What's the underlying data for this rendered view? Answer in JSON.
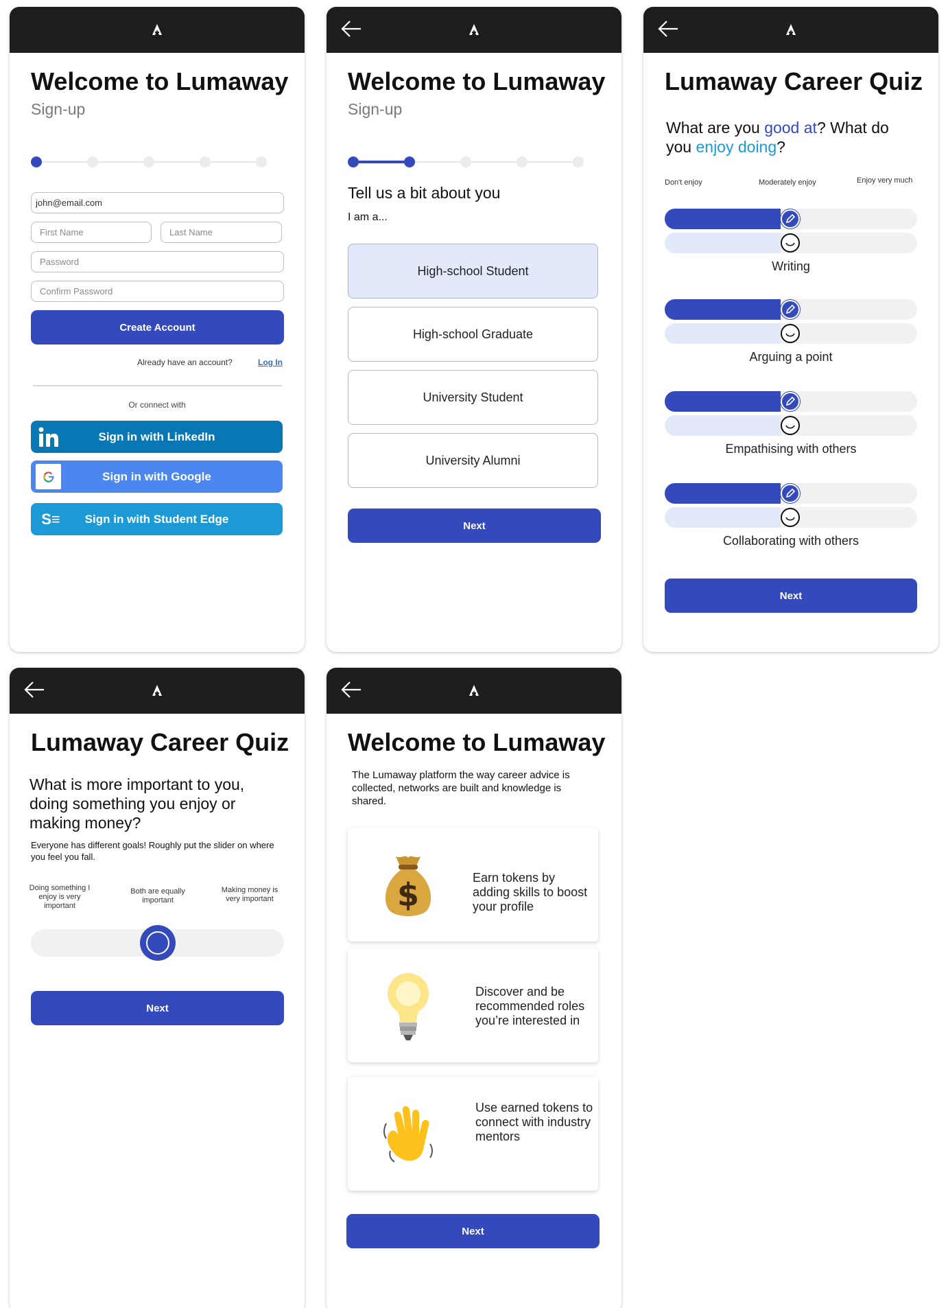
{
  "screen1": {
    "title": "Welcome to Lumaway",
    "subtitle": "Sign-up",
    "email_value": "john@email.com",
    "first_name_placeholder": "First Name",
    "last_name_placeholder": "Last Name",
    "password_placeholder": "Password",
    "confirm_password_placeholder": "Confirm Password",
    "create_account": "Create Account",
    "have_account": "Already have an account?",
    "login_link": "Log In",
    "or_connect": "Or connect with",
    "linkedin": "Sign in with LinkedIn",
    "google": "Sign in with Google",
    "student_edge": "Sign in with Student Edge",
    "student_edge_logo": "S≡"
  },
  "screen2": {
    "title": "Welcome to Lumaway",
    "subtitle": "Sign-up",
    "heading": "Tell us a bit about you",
    "prompt": "I am a...",
    "options": [
      "High-school Student",
      "High-school Graduate",
      "University Student",
      "University Alumni"
    ],
    "selected": "High-school Student",
    "next": "Next"
  },
  "screen3": {
    "title": "Lumaway Career Quiz",
    "question_pre": "What are you ",
    "question_good_at": "good at",
    "question_mid": "? What do you ",
    "question_enjoy": "enjoy doing",
    "question_end": "?",
    "scale_low": "Don't enjoy",
    "scale_mid": "Moderately enjoy",
    "scale_high": "Enjoy very much",
    "skills": [
      {
        "label": "Writing",
        "skill_level": 0.46,
        "enjoy_level": 0.46
      },
      {
        "label": "Arguing a point",
        "skill_level": 0.46,
        "enjoy_level": 0.46
      },
      {
        "label": "Empathising with others",
        "skill_level": 0.46,
        "enjoy_level": 0.46
      },
      {
        "label": "Collaborating with others",
        "skill_level": 0.46,
        "enjoy_level": 0.46
      }
    ],
    "next": "Next",
    "colors": {
      "good_at": "#3449bb",
      "enjoy": "#1c9ad6"
    }
  },
  "screen4": {
    "title": "Lumaway Career Quiz",
    "question": "What is more important to you, doing something you enjoy or making money?",
    "helper": "Everyone has different goals! Roughly put the slider on where you feel you fall.",
    "label_left": "Doing something I enjoy is very important",
    "label_mid": "Both are equally important",
    "label_right": "Making money is very important",
    "slider_value": 0.5,
    "next": "Next"
  },
  "screen5": {
    "title": "Welcome to Lumaway",
    "intro": "The Lumaway platform the way career advice is collected, networks are built and knowledge is shared.",
    "cards": [
      {
        "icon": "money-bag-icon",
        "text": "Earn tokens by adding skills to boost your profile"
      },
      {
        "icon": "light-bulb-icon",
        "text": "Discover and be recommended roles you’re interested in"
      },
      {
        "icon": "waving-hand-icon",
        "text": "Use earned tokens to connect with industry mentors"
      }
    ],
    "next": "Next"
  },
  "colors": {
    "primary": "#3449bb",
    "linkedin": "#0a77b5",
    "google": "#4b87ee",
    "student_edge": "#1c9ad6",
    "topbar": "#1e1e1e"
  }
}
